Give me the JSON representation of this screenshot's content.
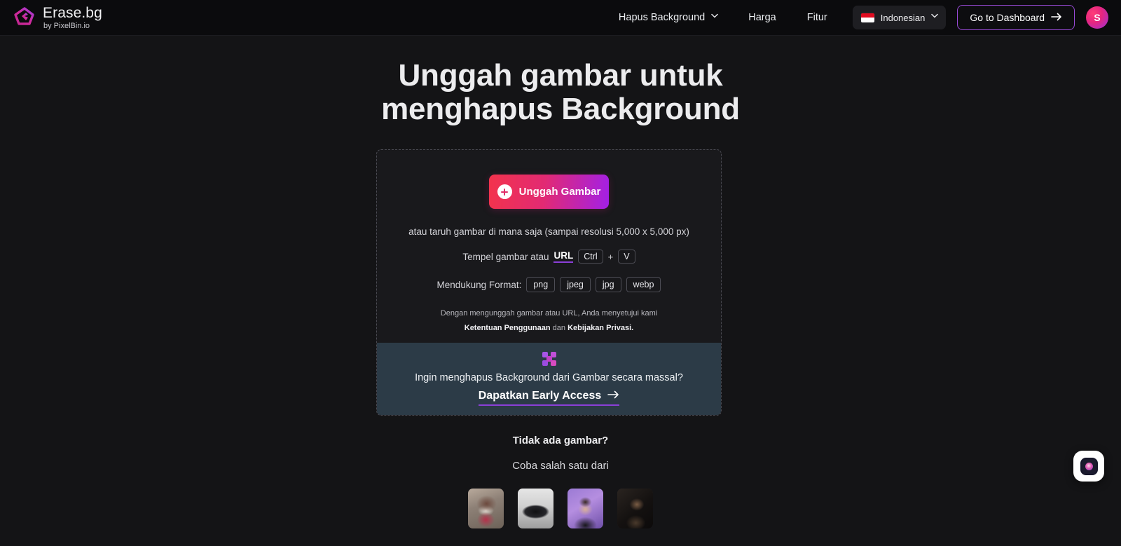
{
  "header": {
    "brand": {
      "name": "Erase.bg",
      "subtitle": "by PixelBin.io",
      "logo_icon": "erasebg-diamond-logo"
    },
    "nav": [
      {
        "label": "Hapus Background",
        "has_caret": true
      },
      {
        "label": "Harga",
        "has_caret": false
      },
      {
        "label": "Fitur",
        "has_caret": false
      }
    ],
    "language": {
      "label": "Indonesian",
      "flag": "indonesia-flag",
      "caret_icon": "chevron-down-icon"
    },
    "dashboard_button": {
      "label": "Go to Dashboard",
      "icon": "arrow-right-icon"
    },
    "avatar": {
      "initial": "S"
    }
  },
  "hero": {
    "title_line1": "Unggah gambar untuk",
    "title_line2": "menghapus Background"
  },
  "upload": {
    "button_label": "Unggah Gambar",
    "button_icon": "plus-circle-icon",
    "drop_hint": "atau taruh gambar di mana saja (sampai resolusi 5,000 x 5,000 px)",
    "paste_prefix": "Tempel gambar atau",
    "paste_link": "URL",
    "key_ctrl": "Ctrl",
    "key_plus": "+",
    "key_v": "V",
    "formats_label": "Mendukung Format:",
    "formats": [
      "png",
      "jpeg",
      "jpg",
      "webp"
    ],
    "terms_prefix": "Dengan mengunggah gambar atau URL, Anda menyetujui kami ",
    "terms_link1": "Ketentuan Penggunaan",
    "terms_middle": " dan ",
    "terms_link2": "Kebijakan Privasi."
  },
  "banner": {
    "icon": "bulk-grid-icon",
    "text": "Ingin menghapus Background dari Gambar secara massal?",
    "cta_label": "Dapatkan Early Access",
    "cta_icon": "arrow-right-icon"
  },
  "samples": {
    "title": "Tidak ada gambar?",
    "subtitle": "Coba salah satu dari",
    "thumbnails": [
      {
        "name": "woman-in-street-sample"
      },
      {
        "name": "black-car-sample"
      },
      {
        "name": "woman-purple-backdrop-sample"
      },
      {
        "name": "man-dark-portrait-sample"
      }
    ]
  },
  "chat": {
    "icon": "chat-bubble-icon"
  },
  "colors": {
    "page_bg": "#141416",
    "header_bg": "#0b0b0d",
    "card_bg": "#19191c",
    "accent_pink": "#f3334c",
    "accent_purple": "#a320e6",
    "banner_bg": "#2c3b47",
    "link_underline": "#8b3fd8"
  }
}
